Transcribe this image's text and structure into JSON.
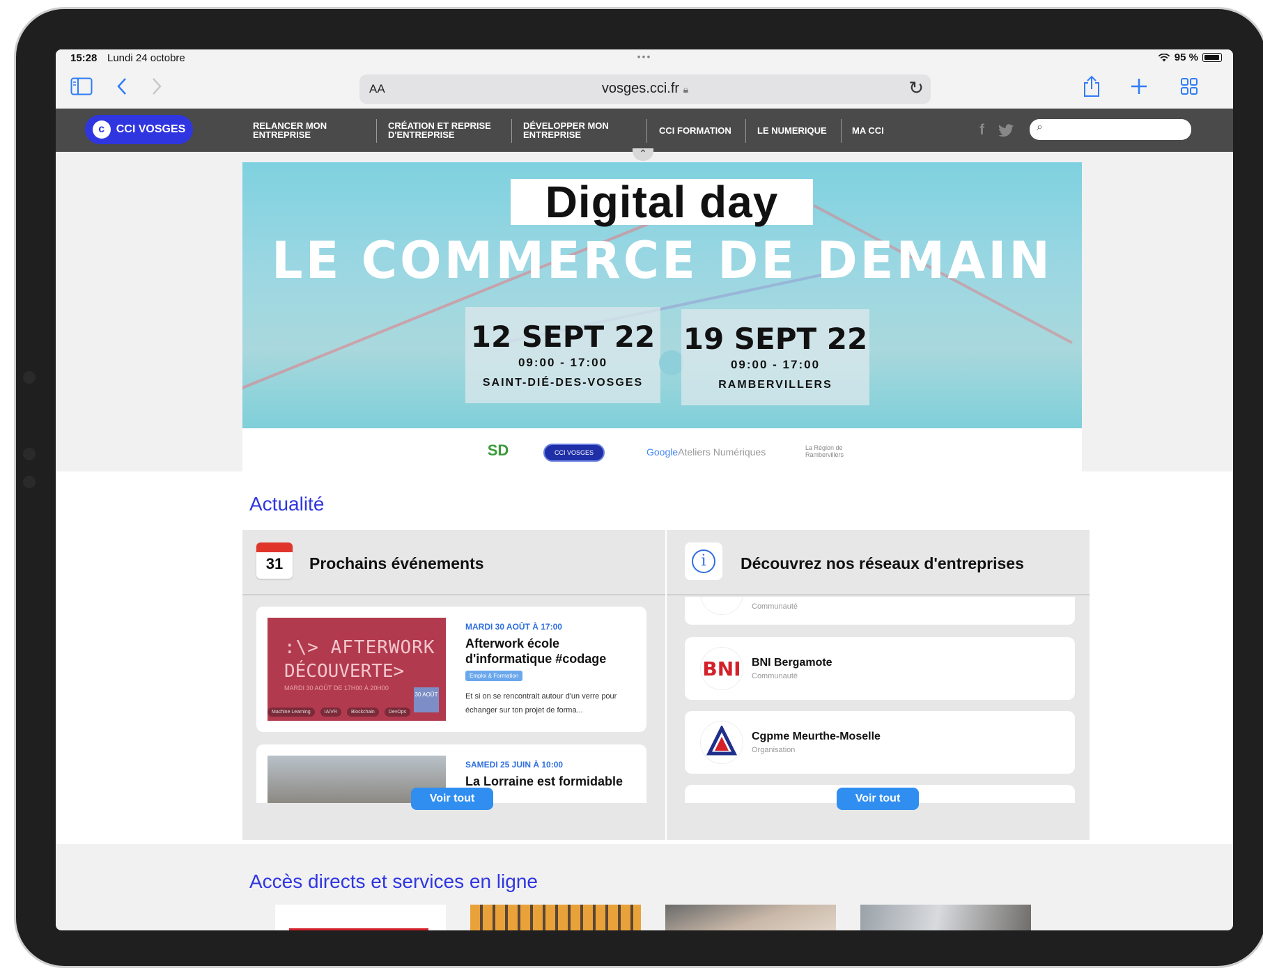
{
  "status": {
    "time": "15:28",
    "date": "Lundi 24 octobre",
    "battery": "95 %"
  },
  "browser": {
    "aa": "AA",
    "url": "vosges.cci.fr"
  },
  "nav": {
    "logo": "CCI VOSGES",
    "items": [
      {
        "label": "RELANCER MON\nENTREPRISE"
      },
      {
        "label": "CRÉATION ET REPRISE\nD'ENTREPRISE"
      },
      {
        "label": "DÉVELOPPER MON\nENTREPRISE"
      },
      {
        "label": "CCI FORMATION"
      },
      {
        "label": "LE NUMERIQUE"
      },
      {
        "label": "MA CCI"
      }
    ],
    "search_placeholder": ""
  },
  "banner": {
    "title": "Digital day",
    "subtitle": "LE COMMERCE DE DEMAIN",
    "tickets": [
      {
        "date": "12 SEPT 22",
        "hours": "09:00 - 17:00",
        "place": "SAINT-DIÉ-DES-VOSGES"
      },
      {
        "date": "19 SEPT 22",
        "hours": "09:00 - 17:00",
        "place": "RAMBERVILLERS"
      }
    ],
    "partners": {
      "sd": "SD",
      "cci": "CCI VOSGES",
      "google_brand": "Google",
      "google_rest": " Ateliers Numériques",
      "region": "La Région de Rambervillers"
    }
  },
  "actualite": {
    "title": "Actualité",
    "events_panel": {
      "icon_day": "31",
      "title": "Prochains événements",
      "events": [
        {
          "date": "MARDI 30 AOÛT À 17:00",
          "title": "Afterwork école d'informatique #codage",
          "tag": "Emploi & Formation",
          "desc": "Et si on se rencontrait autour d'un verre pour échanger sur ton projet de forma...",
          "img_line1": ":\\> AFTERWORK",
          "img_line2": "DÉCOUVERTE>",
          "img_line3": "MARDI 30 AOÛT DE 17H00 À 20H00",
          "img_badge": "30 AOÛT",
          "img_pills": [
            "Machine Learning",
            "IA/VR",
            "Blockchain",
            "DevOps"
          ]
        },
        {
          "date": "SAMEDI 25 JUIN À 10:00",
          "title": "La Lorraine est formidable !"
        }
      ],
      "button": "Voir tout"
    },
    "networks_panel": {
      "title": "Découvrez nos réseaux d'entreprises",
      "items": [
        {
          "name": "",
          "type": "Communauté"
        },
        {
          "name": "BNI Bergamote",
          "type": "Communauté",
          "logo": "BNI"
        },
        {
          "name": "Cgpme Meurthe-Moselle",
          "type": "Organisation",
          "logo": "CGPME"
        }
      ],
      "button": "Voir tout"
    }
  },
  "acces": {
    "title": "Accès directs et services en ligne"
  },
  "colors": {
    "brand": "#2f36e0",
    "nav_bg": "#4a4a4a",
    "button": "#2f8ef0",
    "link_date": "#2f6fe0"
  }
}
